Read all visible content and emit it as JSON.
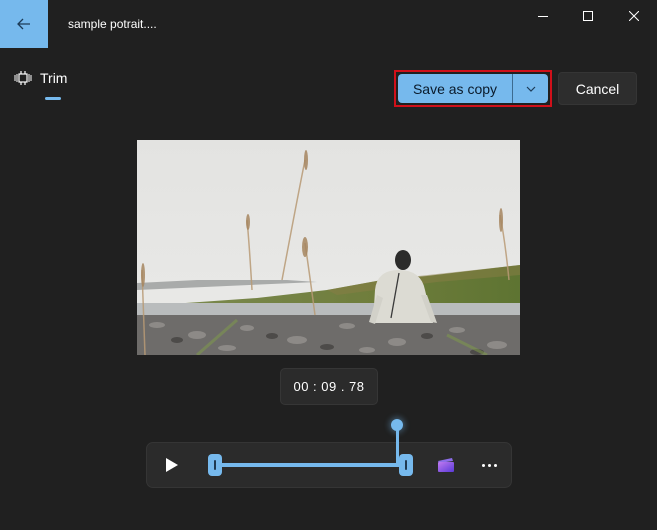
{
  "window": {
    "title": "sample potrait....",
    "controls": {
      "minimize": "minimize-icon",
      "maximize": "maximize-icon",
      "close": "close-icon"
    }
  },
  "header": {
    "back_icon": "arrow-left-icon",
    "trim_tab": {
      "label": "Trim",
      "icon": "trim-icon",
      "active": true
    },
    "save_as_copy_label": "Save as copy",
    "save_dropdown_icon": "chevron-down-icon",
    "cancel_label": "Cancel"
  },
  "video": {
    "description": "Person in white jacket and dark beanie sitting on rocky riverbank facing a green hill under overcast sky, tall grass stalks in foreground"
  },
  "timecode": {
    "display": "00 : 09 . 78"
  },
  "player": {
    "play_icon": "play-icon",
    "trim_start_fraction": 0.0,
    "trim_end_fraction": 1.0,
    "playhead_fraction": 0.96,
    "clip_icon": "clapperboard-icon",
    "more_icon": "more-horizontal-icon"
  },
  "colors": {
    "accent": "#76b9ed",
    "background": "#202020",
    "highlight_border": "#d0101a",
    "control_surface": "#2b2b2b"
  }
}
